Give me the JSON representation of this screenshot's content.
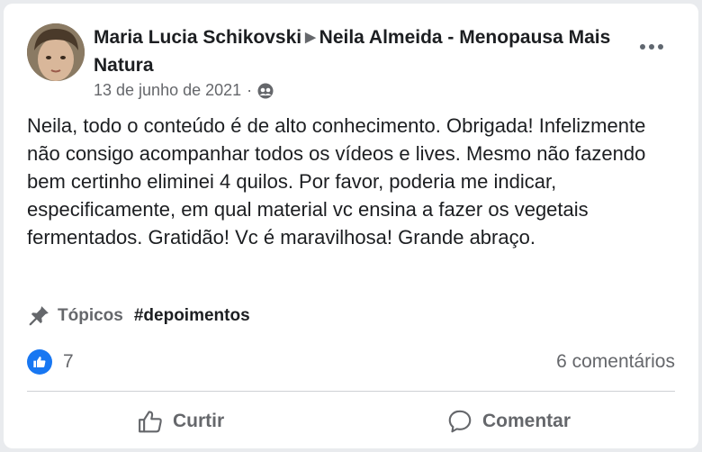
{
  "post": {
    "author": "Maria Lucia Schikovski",
    "group": "Neila Almeida - Menopausa Mais Natura",
    "date": "13 de junho de 2021",
    "date_separator": "·",
    "body": "Neila, todo o conteúdo é de alto conhecimento. Obrigada! Infelizmente não consigo acompanhar todos os vídeos e lives. Mesmo não fazendo bem certinho eliminei 4 quilos. Por favor, poderia me indicar, especificamente, em qual material vc ensina a fazer os vegetais fermentados. Gratidão! Vc é maravilhosa! Grande abraço.",
    "topics_label": "Tópicos",
    "topic": "#depoimentos",
    "reaction_count": "7",
    "comments_count": "6 comentários"
  },
  "actions": {
    "like_label": "Curtir",
    "comment_label": "Comentar"
  },
  "icons": {
    "privacy": "group-members-icon",
    "topics": "pin-icon",
    "reaction": "like-reaction-icon",
    "more": "more-options-icon",
    "like": "thumbs-up-icon",
    "comment": "comment-bubble-icon"
  },
  "colors": {
    "accent": "#1877f2",
    "secondary_text": "#65676b",
    "primary_text": "#1c1e21"
  }
}
